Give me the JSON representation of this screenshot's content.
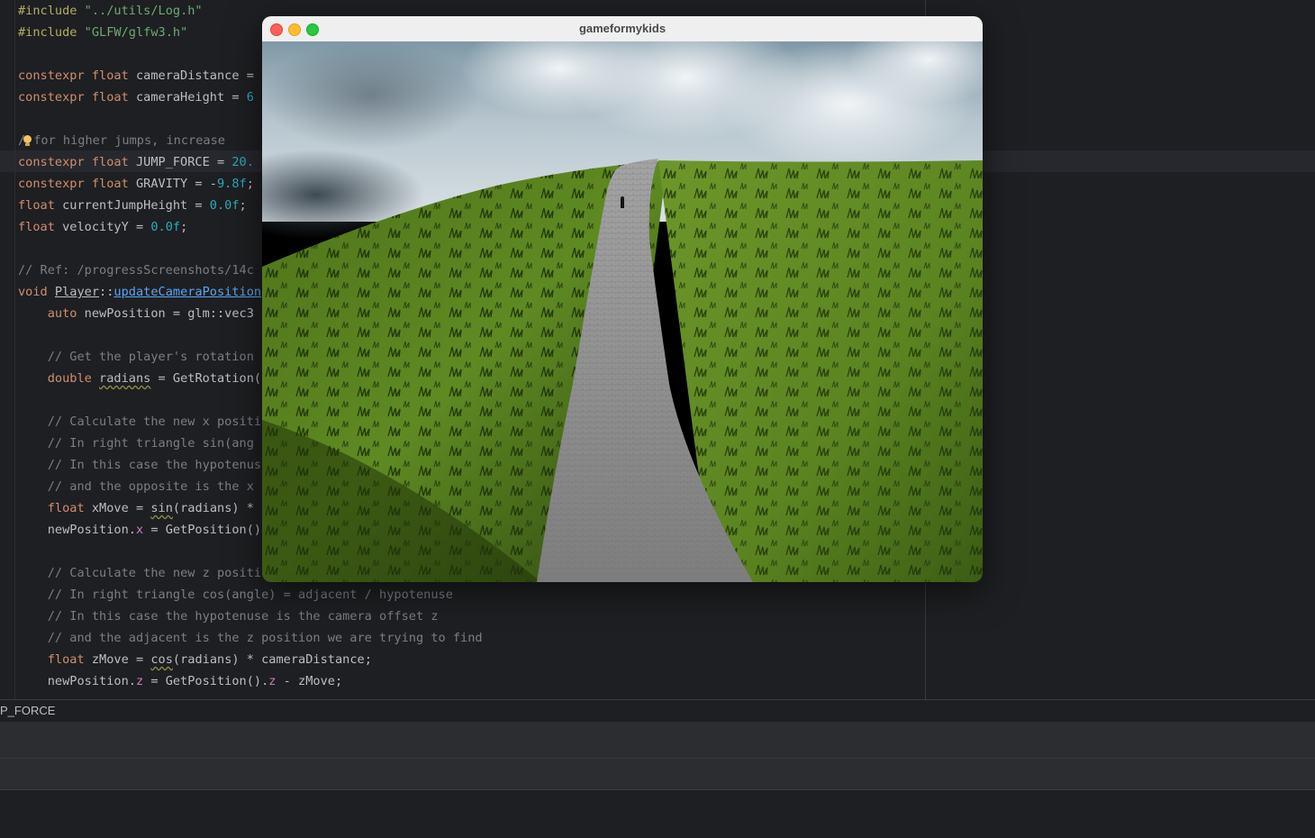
{
  "editor": {
    "lines": [
      [
        {
          "t": "#include ",
          "c": "pp"
        },
        {
          "t": "\"../utils/Log.h\"",
          "c": "str"
        }
      ],
      [
        {
          "t": "#include ",
          "c": "pp"
        },
        {
          "t": "\"GLFW/glfw3.h\"",
          "c": "str"
        }
      ],
      [],
      [
        {
          "t": "constexpr ",
          "c": "kw"
        },
        {
          "t": "float ",
          "c": "kw"
        },
        {
          "t": "cameraDistance ="
        }
      ],
      [
        {
          "t": "constexpr ",
          "c": "kw"
        },
        {
          "t": "float ",
          "c": "kw"
        },
        {
          "t": "cameraHeight = "
        },
        {
          "t": "6",
          "c": "num"
        }
      ],
      [],
      [
        {
          "t": "/",
          "c": "cmt"
        },
        {
          "t": "",
          "c": "bulb"
        },
        {
          "t": "for higher jumps, increase",
          "c": "cmt"
        }
      ],
      [
        {
          "t": "constexpr ",
          "c": "kw"
        },
        {
          "t": "float ",
          "c": "kw"
        },
        {
          "t": "JUMP_FORCE = "
        },
        {
          "t": "20.",
          "c": "num"
        }
      ],
      [
        {
          "t": "constexpr ",
          "c": "kw"
        },
        {
          "t": "float ",
          "c": "kw"
        },
        {
          "t": "GRAVITY = -"
        },
        {
          "t": "9.8f",
          "c": "num"
        },
        {
          "t": ";"
        }
      ],
      [
        {
          "t": "float ",
          "c": "kw"
        },
        {
          "t": "currentJumpHeight = "
        },
        {
          "t": "0.0f",
          "c": "num"
        },
        {
          "t": ";"
        }
      ],
      [
        {
          "t": "float ",
          "c": "kw"
        },
        {
          "t": "velocityY = "
        },
        {
          "t": "0.0f",
          "c": "num"
        },
        {
          "t": ";"
        }
      ],
      [],
      [
        {
          "t": "// Ref: /progressScreenshots/14c",
          "c": "cmt"
        }
      ],
      [
        {
          "t": "void ",
          "c": "kw"
        },
        {
          "t": "Player",
          "c": "cls"
        },
        {
          "t": "::"
        },
        {
          "t": "updateCameraPosition",
          "c": "fn"
        }
      ],
      [
        {
          "t": "    "
        },
        {
          "t": "auto ",
          "c": "kw"
        },
        {
          "t": "newPosition = glm::vec3"
        }
      ],
      [],
      [
        {
          "t": "    "
        },
        {
          "t": "// Get the player's rotation",
          "c": "cmt"
        }
      ],
      [
        {
          "t": "    "
        },
        {
          "t": "double ",
          "c": "kw"
        },
        {
          "t": "radians",
          "c": "wavy"
        },
        {
          "t": " = GetRotation("
        }
      ],
      [],
      [
        {
          "t": "    "
        },
        {
          "t": "// Calculate the new x positi",
          "c": "cmt"
        }
      ],
      [
        {
          "t": "    "
        },
        {
          "t": "// In right triangle sin(ang",
          "c": "cmt"
        }
      ],
      [
        {
          "t": "    "
        },
        {
          "t": "// In this case the hypotenus",
          "c": "cmt"
        }
      ],
      [
        {
          "t": "    "
        },
        {
          "t": "// and the opposite is the x",
          "c": "cmt"
        }
      ],
      [
        {
          "t": "    "
        },
        {
          "t": "float ",
          "c": "kw"
        },
        {
          "t": "xMove = "
        },
        {
          "t": "sin",
          "c": "wavy"
        },
        {
          "t": "(radians) *"
        }
      ],
      [
        {
          "t": "    newPosition."
        },
        {
          "t": "x",
          "c": "fld"
        },
        {
          "t": " = GetPosition()"
        }
      ],
      [],
      [
        {
          "t": "    "
        },
        {
          "t": "// Calculate the new z positi",
          "c": "cmt"
        }
      ],
      [
        {
          "t": "    "
        },
        {
          "t": "// In right triangle cos(angle) = adjacent / hypotenuse",
          "c": "cmt"
        }
      ],
      [
        {
          "t": "    "
        },
        {
          "t": "// In this case the hypotenuse is the camera offset z",
          "c": "cmt"
        }
      ],
      [
        {
          "t": "    "
        },
        {
          "t": "// and the adjacent is the z position we are trying to find",
          "c": "cmt"
        }
      ],
      [
        {
          "t": "    "
        },
        {
          "t": "float ",
          "c": "kw"
        },
        {
          "t": "zMove = "
        },
        {
          "t": "cos",
          "c": "wavy"
        },
        {
          "t": "(radians) * cameraDistance;"
        }
      ],
      [
        {
          "t": "    newPosition."
        },
        {
          "t": "z",
          "c": "fld"
        },
        {
          "t": " = GetPosition()."
        },
        {
          "t": "z",
          "c": "fld"
        },
        {
          "t": " - zMove;"
        }
      ]
    ]
  },
  "find_bar": {
    "text": "P_FORCE"
  },
  "game_window": {
    "title": "gameformykids",
    "colors": {
      "grass_dark": "#2f4a12",
      "grass_light": "#6f9a2a",
      "path": "#8c8c8c",
      "sky": "#9fb2bd"
    }
  }
}
